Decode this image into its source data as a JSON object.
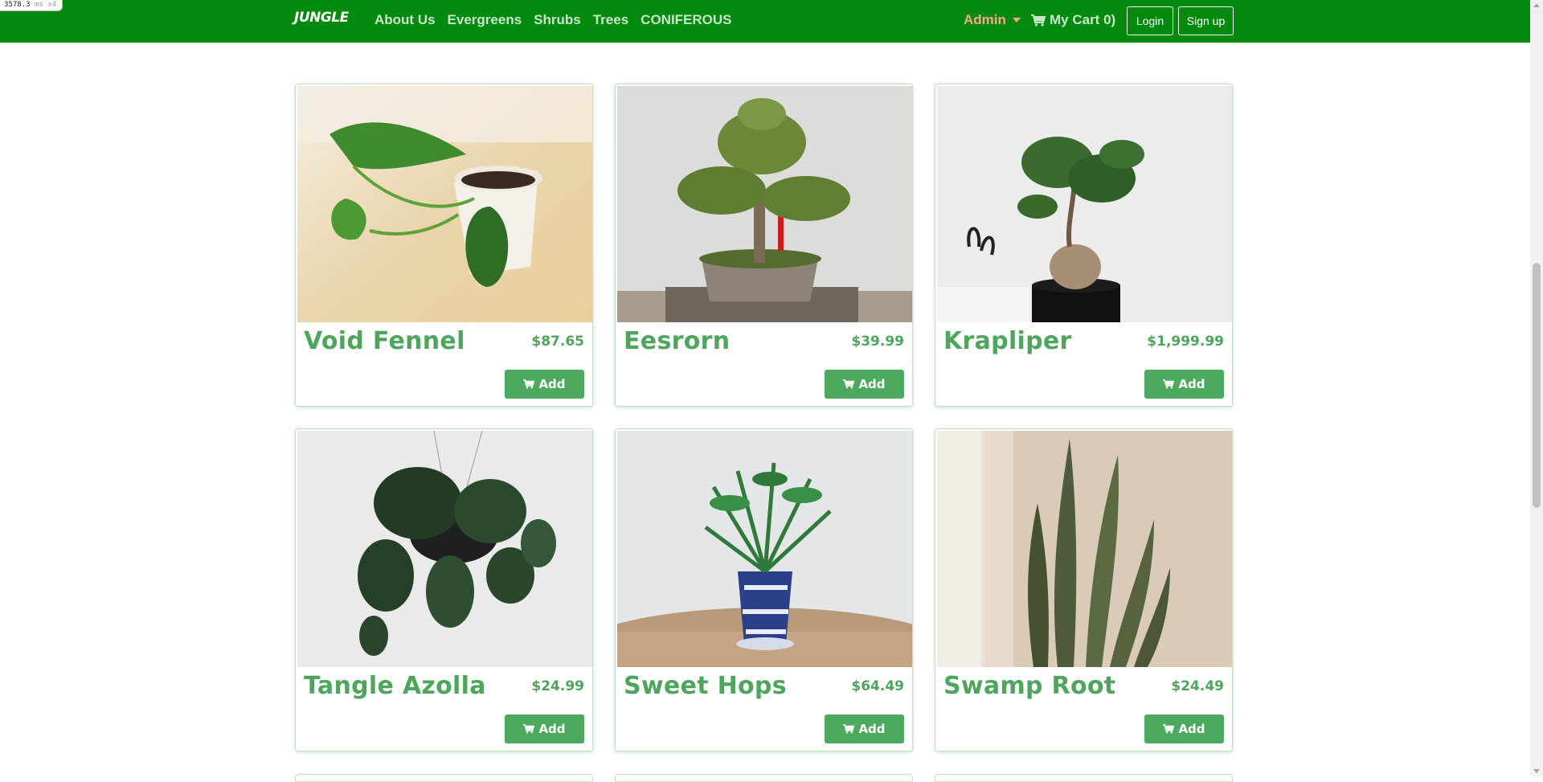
{
  "debug": {
    "time": "3578.3",
    "unit": "ms",
    "suffix": "x4"
  },
  "nav": {
    "brand": "JUNGLE",
    "links": [
      "About Us",
      "Evergreens",
      "Shrubs",
      "Trees",
      "CONIFEROUS"
    ],
    "admin_label": "Admin",
    "cart_label": "My Cart 0)",
    "login_label": "Login",
    "signup_label": "Sign up"
  },
  "products": [
    {
      "name": "Void Fennel",
      "price": "$87.65",
      "button": "Add",
      "image": "pothos-in-white-pot"
    },
    {
      "name": "Eesrorn",
      "price": "$39.99",
      "button": "Add",
      "image": "bonsai-tree"
    },
    {
      "name": "Krapliper",
      "price": "$1,999.99",
      "button": "Add",
      "image": "ficus-bonsai-black-pot"
    },
    {
      "name": "Tangle Azolla",
      "price": "$24.99",
      "button": "Add",
      "image": "hanging-philodendron"
    },
    {
      "name": "Sweet Hops",
      "price": "$64.49",
      "button": "Add",
      "image": "palm-in-blue-pot"
    },
    {
      "name": "Swamp Root",
      "price": "$24.49",
      "button": "Add",
      "image": "snake-plant"
    }
  ],
  "colors": {
    "navbar": "#028a0f",
    "accent": "#4ea65d",
    "admin": "#f8a98b",
    "button": "#4caa5e"
  }
}
